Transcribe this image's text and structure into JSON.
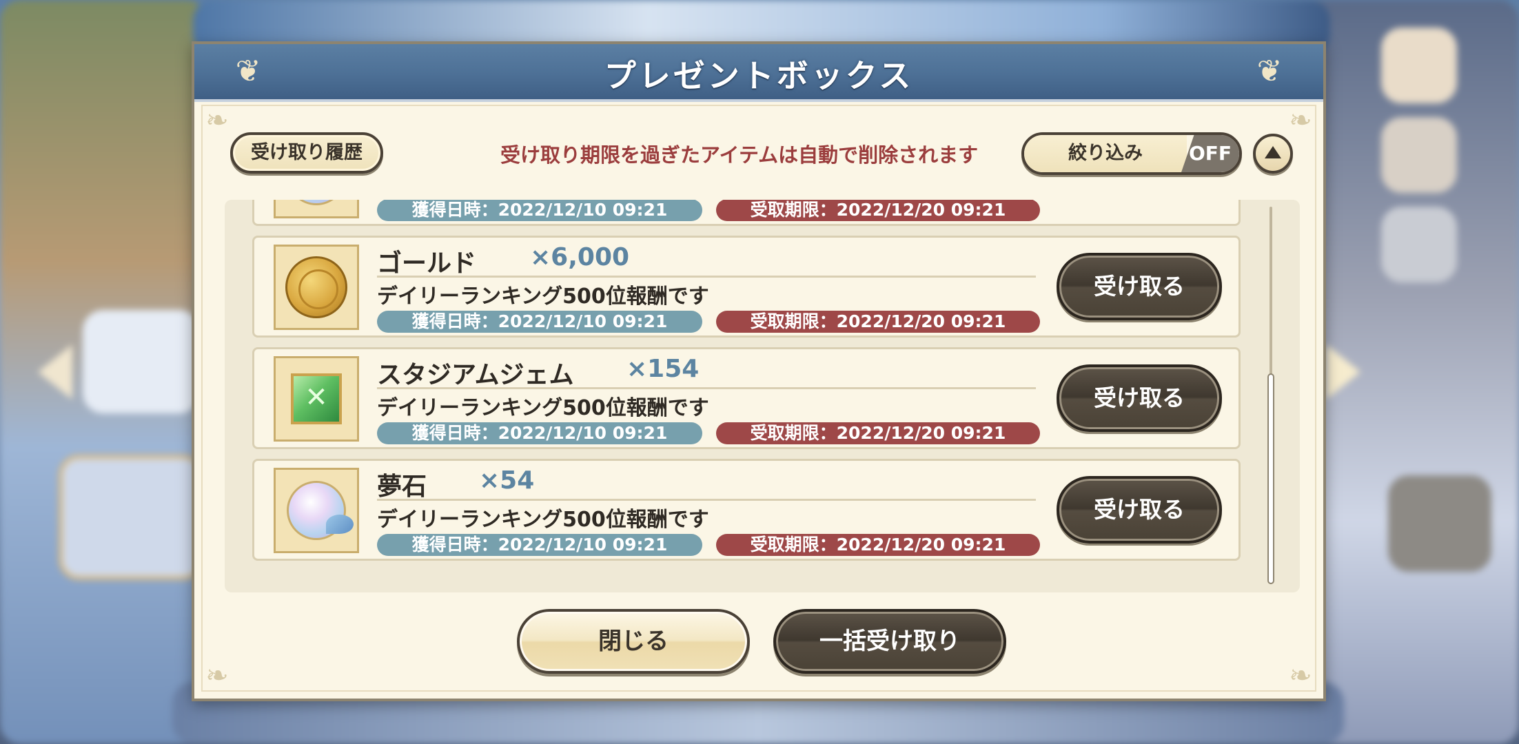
{
  "modal": {
    "title": "プレゼントボックス",
    "history_button": "受け取り履歴",
    "notice": "受け取り期限を過ぎたアイテムは自動で削除されます",
    "filter": {
      "label": "絞り込み",
      "state": "OFF"
    }
  },
  "gifts": [
    {
      "name": "",
      "quantity": "",
      "description": "",
      "acquired": "獲得日時：2022/12/10 09:21",
      "expires": "受取期限：2022/12/20 09:21",
      "icon": "dream-stone-icon",
      "claim_label": ""
    },
    {
      "name": "ゴールド",
      "quantity": "×6,000",
      "description": "デイリーランキング500位報酬です",
      "acquired": "獲得日時：2022/12/10 09:21",
      "expires": "受取期限：2022/12/20 09:21",
      "icon": "gold-coin-icon",
      "claim_label": "受け取る"
    },
    {
      "name": "スタジアムジェム",
      "quantity": "×154",
      "description": "デイリーランキング500位報酬です",
      "acquired": "獲得日時：2022/12/10 09:21",
      "expires": "受取期限：2022/12/20 09:21",
      "icon": "stadium-gem-icon",
      "claim_label": "受け取る"
    },
    {
      "name": "夢石",
      "quantity": "×54",
      "description": "デイリーランキング500位報酬です",
      "acquired": "獲得日時：2022/12/10 09:21",
      "expires": "受取期限：2022/12/20 09:21",
      "icon": "dream-stone-icon",
      "claim_label": "受け取る"
    }
  ],
  "footer": {
    "close_button": "閉じる",
    "claim_all_button": "一括受け取り"
  },
  "colors": {
    "title_bar": "#4d7096",
    "panel": "#fbf6e6",
    "acquired_pill": "#77a0ad",
    "expiry_pill": "#9e4848",
    "quantity_text": "#5c84a1",
    "notice_text": "#9b3d3d",
    "dark_button": "#3f382f"
  }
}
